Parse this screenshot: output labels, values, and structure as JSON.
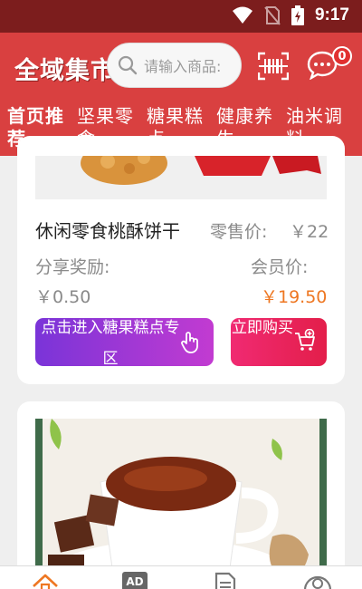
{
  "status_bar": {
    "time": "9:17"
  },
  "header": {
    "logo": "全域集市",
    "search_placeholder": "请输入商品:",
    "message_count": "0"
  },
  "tabs": [
    {
      "line1": "首页推",
      "line2": "荐",
      "active": true
    },
    {
      "line1": "坚果零",
      "line2": "食"
    },
    {
      "line1": "糖果糕",
      "line2": "点"
    },
    {
      "line1": "健康养",
      "line2": "生"
    },
    {
      "line1": "油米调",
      "line2": "料"
    }
  ],
  "products": [
    {
      "name": "休闲零食桃酥饼干",
      "retail_label": "零售价:",
      "retail_price": "￥22",
      "share_label": "分享奖励:",
      "share_value": "￥0.50",
      "member_label": "会员价:",
      "member_price": "￥19.50",
      "enter_button": "点击进入糖果糕点专区",
      "buy_button": "立即购买"
    }
  ],
  "colors": {
    "status_bar": "#7c1d1d",
    "header": "#d94040",
    "member_price": "#ee7722",
    "enter_button_start": "#7a34d8",
    "enter_button_end": "#c23bd1",
    "buy_button": "#f02a72"
  },
  "icons": {
    "search": "search-icon",
    "scan": "barcode-scan-icon",
    "message": "chat-bubble-icon",
    "enter": "hand-pointer-icon",
    "buy": "cart-add-icon",
    "nav": [
      "home-icon",
      "ad-icon",
      "document-icon",
      "user-icon"
    ]
  },
  "bottom_nav": [
    {
      "name": "home"
    },
    {
      "name": "ad",
      "badge_text": "AD"
    },
    {
      "name": "orders"
    },
    {
      "name": "profile"
    }
  ]
}
